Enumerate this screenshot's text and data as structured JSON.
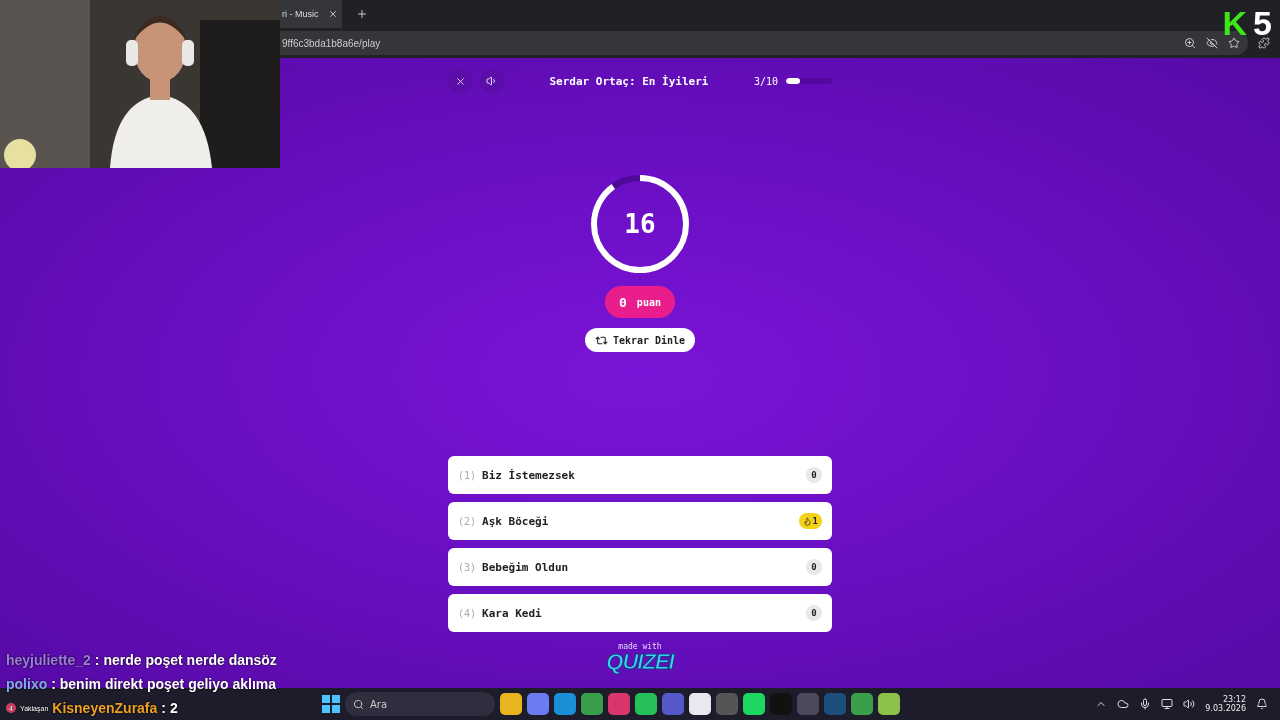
{
  "browser": {
    "tab_title": "ri - Music",
    "url": "9ff6c3bda1b8a6e/play"
  },
  "quiz": {
    "title": "Serdar Ortaç: En İyileri",
    "progress_text": "3/10",
    "progress": {
      "level": 0.3
    },
    "timer": {
      "value": "16",
      "level": 0.9
    },
    "score": {
      "value": "0",
      "unit": "puan"
    },
    "replay_label": "Tekrar Dinle",
    "answers": [
      {
        "number": "(1)",
        "label": "Biz İstemezsek",
        "count": "0",
        "highlighted": false
      },
      {
        "number": "(2)",
        "label": "Aşk Böceği",
        "count": "1",
        "highlighted": true
      },
      {
        "number": "(3)",
        "label": "Bebeğim Oldun",
        "count": "0",
        "highlighted": false
      },
      {
        "number": "(4)",
        "label": "Kara Kedi",
        "count": "0",
        "highlighted": false
      }
    ],
    "footer": {
      "made_with": "made with",
      "brand": "QUIZEI"
    }
  },
  "stream_overlay": {
    "logo": {
      "letter": "K",
      "number": "5"
    },
    "chat": [
      {
        "user": "heyjuliette_2",
        "message": ": nerde poşet nerde dansöz",
        "color": "#9a7fd8"
      },
      {
        "user": "polixo",
        "message": ": benim direkt poşet geliyo aklıma",
        "color": "#86a9e6"
      }
    ],
    "notice": {
      "count": "4",
      "label": "Yaklaşan"
    },
    "counter": {
      "label": "KisneyenZurafa",
      "value": ": 2"
    }
  },
  "taskbar": {
    "search_placeholder": "Ara",
    "clock_time": "23:12",
    "clock_date": "9.03.2026"
  }
}
